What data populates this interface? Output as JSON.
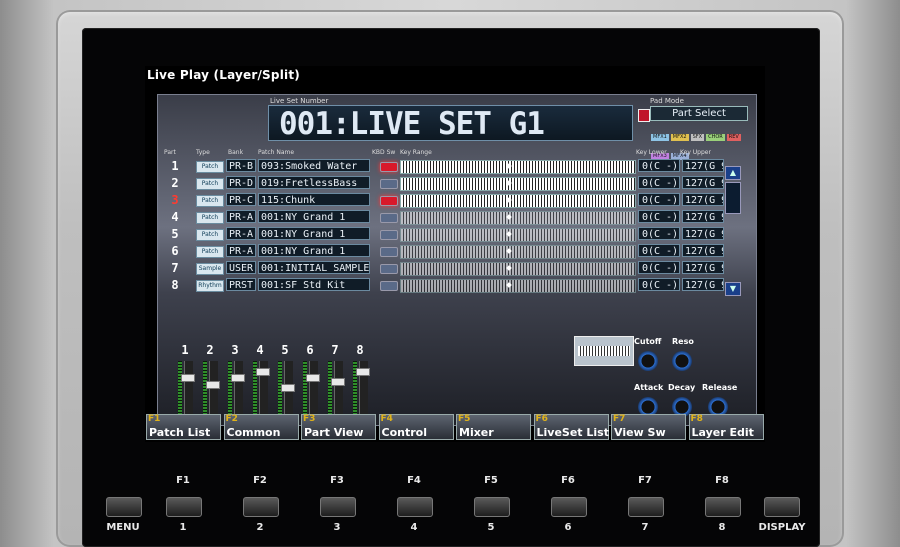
{
  "screen": {
    "title": "Live Play (Layer/Split)",
    "live_set_label": "Live Set Number",
    "live_set_name": "001:LIVE SET G1",
    "pad_mode_label": "Pad Mode",
    "pad_mode_value": "Part Select",
    "pad_tags": [
      "MFX1",
      "MFX2",
      "SFX",
      "CHOR",
      "REV",
      "MFX3",
      "MFX4"
    ]
  },
  "table": {
    "headers": {
      "part": "Part",
      "type": "Type",
      "bank": "Bank",
      "patch": "Patch Name",
      "key_sw": "KBD Sw",
      "key_range": "Key Range",
      "key_lower": "Key Lower",
      "key_upper": "Key Upper"
    },
    "rows": [
      {
        "part": "1",
        "type": "Patch",
        "bank": "PR-B",
        "patch": "093:Smoked Water",
        "lower": "0(C -)",
        "upper": "127(G 9)",
        "led": true,
        "dim": false
      },
      {
        "part": "2",
        "type": "Patch",
        "bank": "PR-D",
        "patch": "019:FretlessBass",
        "lower": "0(C -)",
        "upper": "127(G 9)",
        "led": false,
        "dim": false
      },
      {
        "part": "3",
        "type": "Patch",
        "bank": "PR-C",
        "patch": "115:Chunk",
        "lower": "0(C -)",
        "upper": "127(G 9)",
        "led": true,
        "dim": false
      },
      {
        "part": "4",
        "type": "Patch",
        "bank": "PR-A",
        "patch": "001:NY Grand 1",
        "lower": "0(C -)",
        "upper": "127(G 9)",
        "led": false,
        "dim": true
      },
      {
        "part": "5",
        "type": "Patch",
        "bank": "PR-A",
        "patch": "001:NY Grand 1",
        "lower": "0(C -)",
        "upper": "127(G 9)",
        "led": false,
        "dim": true
      },
      {
        "part": "6",
        "type": "Patch",
        "bank": "PR-A",
        "patch": "001:NY Grand 1",
        "lower": "0(C -)",
        "upper": "127(G 9)",
        "led": false,
        "dim": true
      },
      {
        "part": "7",
        "type": "Sample",
        "bank": "USER",
        "patch": "001:INITIAL SAMPLE",
        "lower": "0(C -)",
        "upper": "127(G 9)",
        "led": false,
        "dim": true
      },
      {
        "part": "8",
        "type": "Rhythm",
        "bank": "PRST",
        "patch": "001:SF Std Kit",
        "lower": "0(C -)",
        "upper": "127(G 9)",
        "led": false,
        "dim": true
      }
    ]
  },
  "faders": [
    {
      "num": "1",
      "level": 0.2
    },
    {
      "num": "2",
      "level": 0.3
    },
    {
      "num": "3",
      "level": 0.2
    },
    {
      "num": "4",
      "level": 0.1
    },
    {
      "num": "5",
      "level": 0.35
    },
    {
      "num": "6",
      "level": 0.2
    },
    {
      "num": "7",
      "level": 0.25
    },
    {
      "num": "8",
      "level": 0.1
    }
  ],
  "knobs": {
    "cutoff": "Cutoff",
    "reso": "Reso",
    "attack": "Attack",
    "decay": "Decay",
    "release": "Release"
  },
  "function_buttons": [
    {
      "key": "F1",
      "label": "Patch List"
    },
    {
      "key": "F2",
      "label": "Common"
    },
    {
      "key": "F3",
      "label": "Part View"
    },
    {
      "key": "F4",
      "label": "Control"
    },
    {
      "key": "F5",
      "label": "Mixer"
    },
    {
      "key": "F6",
      "label": "LiveSet List"
    },
    {
      "key": "F7",
      "label": "View Sw"
    },
    {
      "key": "F8",
      "label": "Layer Edit"
    }
  ],
  "hardware": {
    "f_labels": [
      "F1",
      "F2",
      "F3",
      "F4",
      "F5",
      "F6",
      "F7",
      "F8"
    ],
    "num_labels": [
      "1",
      "2",
      "3",
      "4",
      "5",
      "6",
      "7",
      "8"
    ],
    "menu": "MENU",
    "display": "DISPLAY"
  },
  "colors": {
    "accent_yellow": "#e0b21a",
    "led_red": "#d8192a",
    "fader_green": "#2f8f2a",
    "screen_blue": "#1b3a6d"
  }
}
